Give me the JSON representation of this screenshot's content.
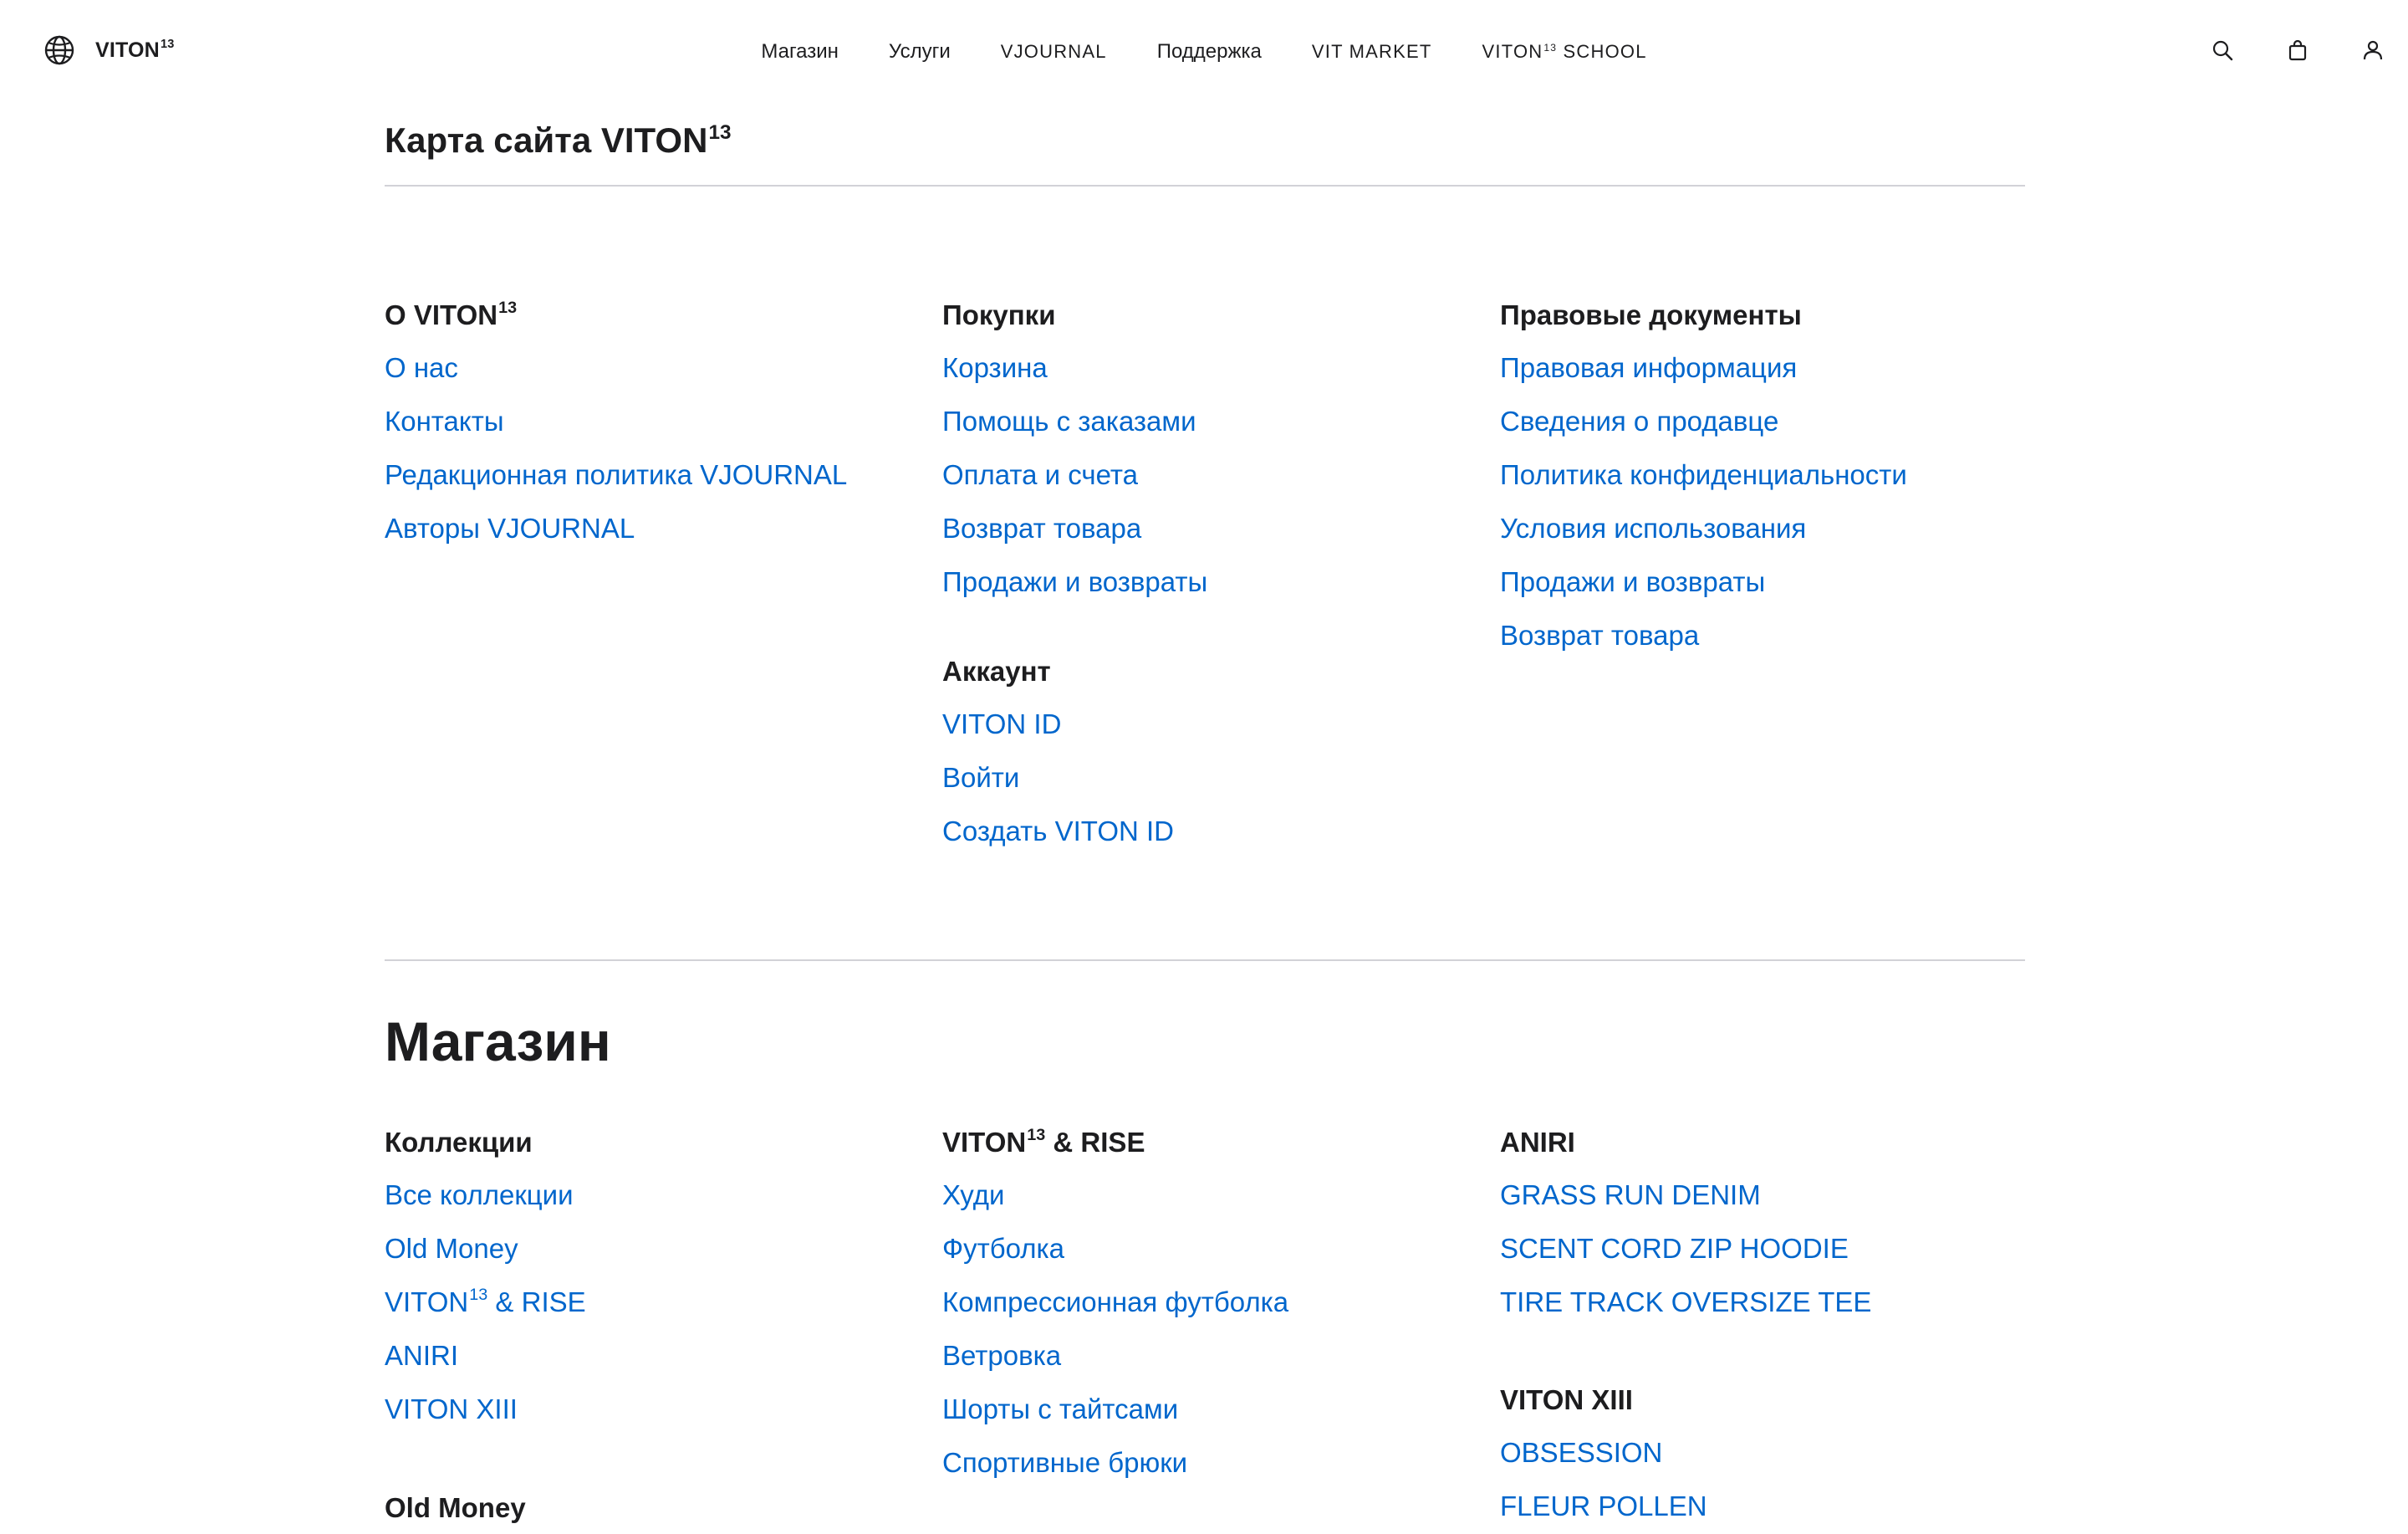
{
  "header": {
    "logo_text": "VITON",
    "logo_sup": "13",
    "nav": {
      "shop": "Магазин",
      "services": "Услуги",
      "vjournal": "VJOURNAL",
      "support": "Поддержка",
      "vit_market": "VIT MARKET",
      "school_pre": "VITON",
      "school_sup": "13",
      "school_post": " SCHOOL"
    },
    "icons": [
      "search-icon",
      "bag-icon",
      "account-icon"
    ]
  },
  "page": {
    "title": "Карта сайта VITON",
    "title_sup": "13"
  },
  "about": {
    "heading": "О VITON",
    "heading_sup": "13",
    "links": [
      "О нас",
      "Контакты",
      "Редакционная политика VJOURNAL",
      "Авторы VJOURNAL"
    ]
  },
  "purchases": {
    "heading": "Покупки",
    "links": [
      "Корзина",
      "Помощь с заказами",
      "Оплата и счета",
      "Возврат товара",
      "Продажи и возвраты"
    ]
  },
  "account": {
    "heading": "Аккаунт",
    "links": [
      "VITON ID",
      "Войти",
      "Создать VITON ID"
    ]
  },
  "legal": {
    "heading": "Правовые документы",
    "links": [
      "Правовая информация",
      "Сведения о продавце",
      "Политика конфиденциальности",
      "Условия использования",
      "Продажи и возвраты",
      "Возврат товара"
    ]
  },
  "shop": {
    "title": "Магазин",
    "collections": {
      "heading": "Коллекции",
      "links": [
        "Все коллекции",
        "Old Money",
        "VITON",
        "ANIRI",
        "VITON XIII"
      ],
      "viton_rise_sup": "13",
      "viton_rise_post": " & RISE"
    },
    "old_money": {
      "heading": "Old Money"
    },
    "viton_rise": {
      "heading": "VITON",
      "heading_sup": "13",
      "heading_post": " & RISE",
      "links": [
        "Худи",
        "Футболка",
        "Компрессионная футболка",
        "Ветровка",
        "Шорты с тайтсами",
        "Спортивные брюки"
      ]
    },
    "aniri": {
      "heading": "ANIRI",
      "links": [
        "GRASS RUN DENIM",
        "SCENT CORD ZIP HOODIE",
        "TIRE TRACK OVERSIZE TEE"
      ]
    },
    "viton_xiii": {
      "heading": "VITON XIII",
      "links": [
        "OBSESSION",
        "FLEUR POLLEN"
      ]
    }
  },
  "colors": {
    "link": "#0066cc",
    "text": "#1d1d1f",
    "divider": "#d2d2d7"
  }
}
